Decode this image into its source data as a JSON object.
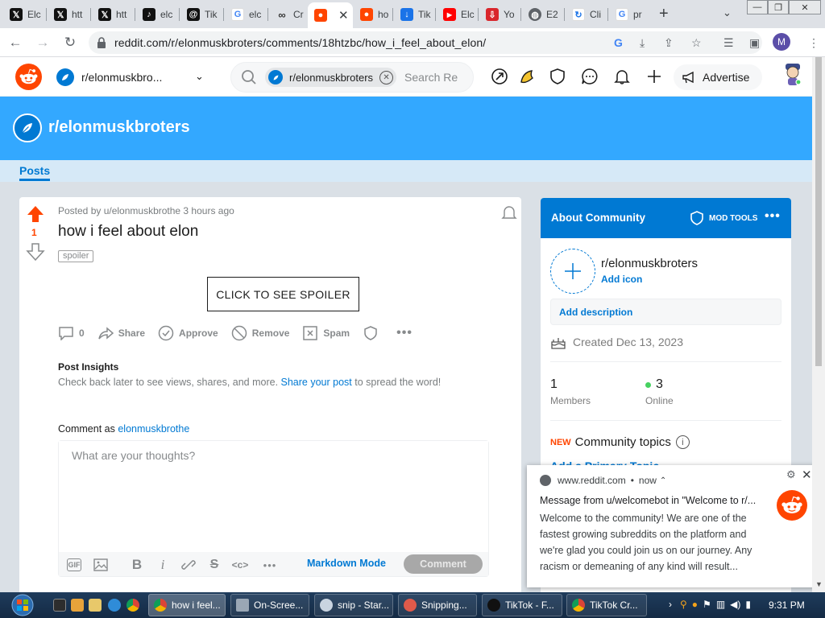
{
  "browser": {
    "tabs": [
      {
        "label": "Elc",
        "icon": "x-logo-icon"
      },
      {
        "label": "htt",
        "icon": "x-logo-icon"
      },
      {
        "label": "htt",
        "icon": "x-logo-icon"
      },
      {
        "label": "elc",
        "icon": "tiktok-icon"
      },
      {
        "label": "Tik",
        "icon": "threads-icon"
      },
      {
        "label": "elc",
        "icon": "google-icon"
      },
      {
        "label": "Cr",
        "icon": "meta-icon"
      },
      {
        "label": "",
        "icon": "reddit-icon",
        "active": true
      },
      {
        "label": "ho",
        "icon": "reddit-icon"
      },
      {
        "label": "Tik",
        "icon": "download-icon"
      },
      {
        "label": "Elc",
        "icon": "youtube-icon"
      },
      {
        "label": "Yo",
        "icon": "save-icon"
      },
      {
        "label": "E2",
        "icon": "globe-icon"
      },
      {
        "label": "Cli",
        "icon": "refresh-icon"
      },
      {
        "label": "pr",
        "icon": "google-icon"
      }
    ],
    "url": "reddit.com/r/elonmuskbroters/comments/18htzbc/how_i_feel_about_elon/",
    "profile_initial": "M"
  },
  "header": {
    "community": "r/elonmuskbro...",
    "search_chip": "r/elonmuskbroters",
    "search_placeholder": "Search Re",
    "advertise": "Advertise"
  },
  "banner": {
    "title": "r/elonmuskbroters",
    "tab": "Posts"
  },
  "post": {
    "votes": "1",
    "meta": "Posted by u/elonmuskbrothe 3 hours ago",
    "title": "how i feel about elon",
    "tag": "spoiler",
    "spoiler_button": "CLICK TO SEE SPOILER",
    "comments": "0",
    "share": "Share",
    "approve": "Approve",
    "remove": "Remove",
    "spam": "Spam",
    "insights_title": "Post Insights",
    "insights_text_before": "Check back later to see views, shares, and more. ",
    "insights_link": "Share your post",
    "insights_text_after": " to spread the word!",
    "comment_as_label": "Comment as ",
    "comment_as_user": "elonmuskbrothe",
    "comment_placeholder": "What are your thoughts?",
    "markdown_mode": "Markdown Mode",
    "comment_button": "Comment"
  },
  "sidebar": {
    "about_title": "About Community",
    "mod_tools": "MOD TOOLS",
    "name": "r/elonmuskbroters",
    "add_icon": "Add icon",
    "add_description": "Add description",
    "created": "Created Dec 13, 2023",
    "members": "1",
    "members_label": "Members",
    "online": "3",
    "online_label": "Online",
    "new_badge": "NEW",
    "topics": "Community topics",
    "topics_link": "Add a Primary Topic"
  },
  "notification": {
    "source": "www.reddit.com",
    "time": "now",
    "title": "Message from u/welcomebot in \"Welcome to r/...",
    "body": "Welcome to the community! We are one of the fastest growing subreddits on the platform and we're glad you could join us on our journey. Any racism or demeaning of any kind will result..."
  },
  "taskbar": {
    "buttons": [
      "how i feel...",
      "On-Scree...",
      "snip - Star...",
      "Snipping...",
      "TikTok - F...",
      "TikTok Cr..."
    ],
    "clock": "9:31 PM"
  },
  "colors": {
    "reddit_orange": "#ff4500",
    "reddit_blue": "#0079d3",
    "banner": "#33a8ff"
  }
}
